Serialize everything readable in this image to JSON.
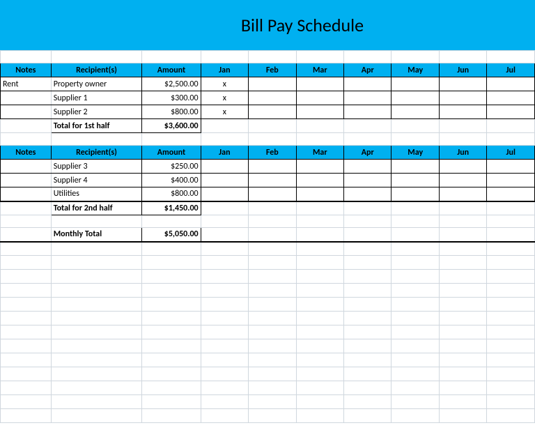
{
  "title": "Bill Pay Schedule",
  "columns": {
    "notes": "Notes",
    "recipients": "Recipient(s)",
    "amount": "Amount",
    "months": [
      "Jan",
      "Feb",
      "Mar",
      "Apr",
      "May",
      "Jun",
      "Jul"
    ]
  },
  "section1": {
    "rows": [
      {
        "notes": "Rent",
        "recipient": "Property owner",
        "amount": "$2,500.00",
        "marks": [
          "x",
          "",
          "",
          "",
          "",
          "",
          ""
        ]
      },
      {
        "notes": "",
        "recipient": "Supplier 1",
        "amount": "$300.00",
        "marks": [
          "x",
          "",
          "",
          "",
          "",
          "",
          ""
        ]
      },
      {
        "notes": "",
        "recipient": "Supplier 2",
        "amount": "$800.00",
        "marks": [
          "x",
          "",
          "",
          "",
          "",
          "",
          ""
        ]
      }
    ],
    "total_label": "Total for 1st half",
    "total_amount": "$3,600.00"
  },
  "section2": {
    "rows": [
      {
        "notes": "",
        "recipient": "Supplier 3",
        "amount": "$250.00",
        "marks": [
          "",
          "",
          "",
          "",
          "",
          "",
          ""
        ]
      },
      {
        "notes": "",
        "recipient": "Supplier 4",
        "amount": "$400.00",
        "marks": [
          "",
          "",
          "",
          "",
          "",
          "",
          ""
        ]
      },
      {
        "notes": "",
        "recipient": "Utilities",
        "amount": "$800.00",
        "marks": [
          "",
          "",
          "",
          "",
          "",
          "",
          ""
        ]
      }
    ],
    "total_label": "Total for 2nd half",
    "total_amount": "$1,450.00"
  },
  "grand_total": {
    "label": "Monthly Total",
    "amount": "$5,050.00"
  }
}
